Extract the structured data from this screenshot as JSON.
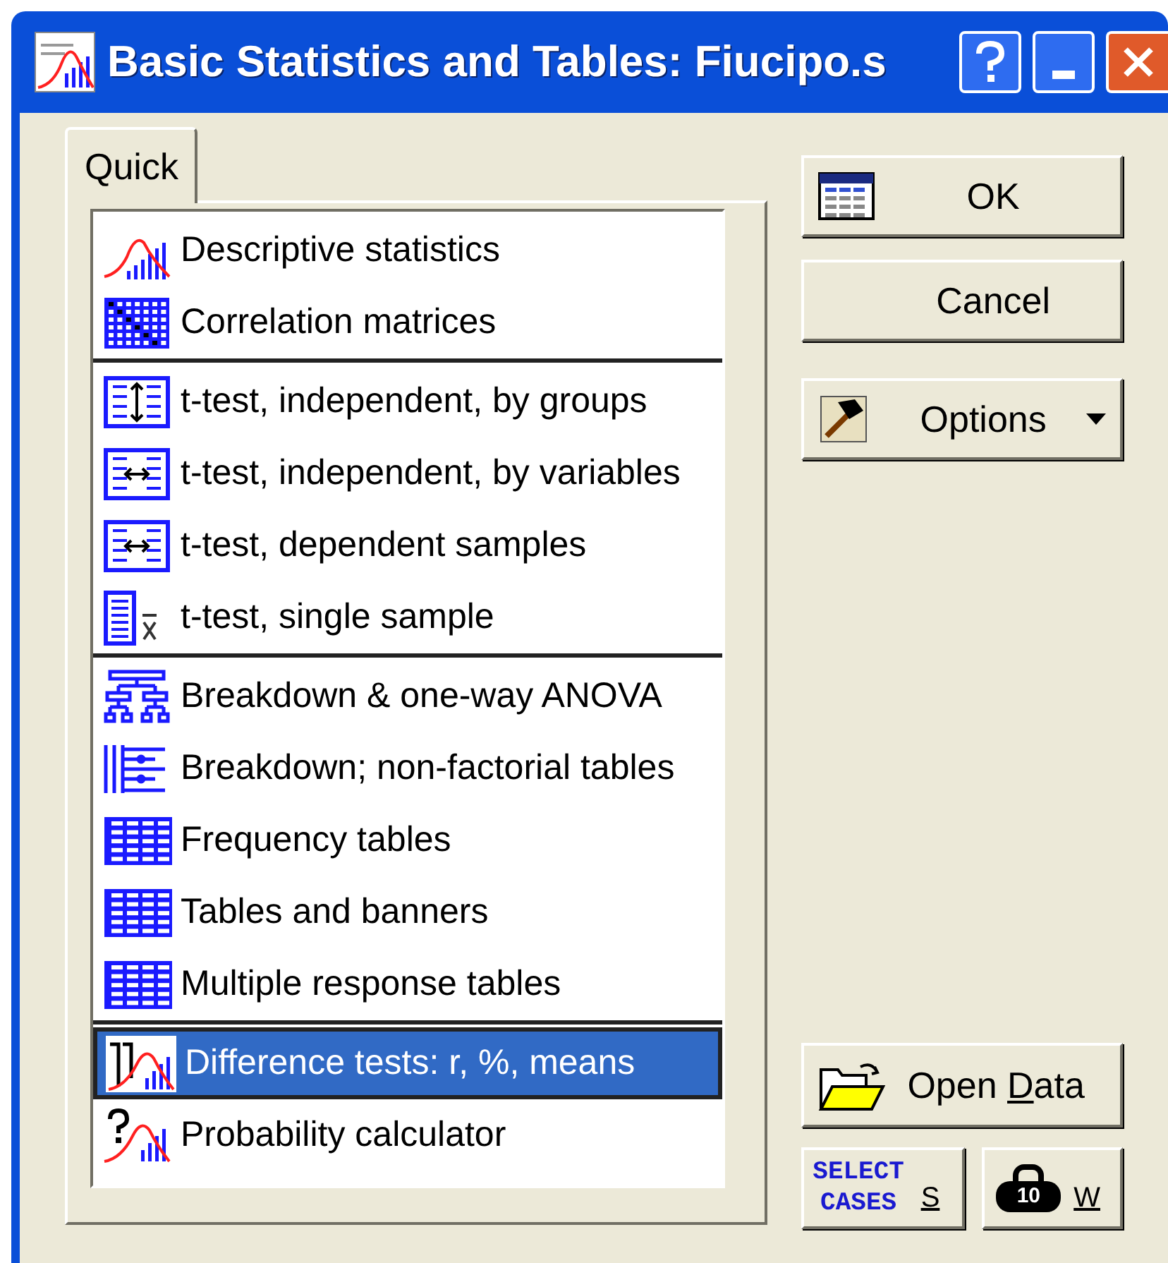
{
  "window": {
    "title": "Basic Statistics and Tables: Fiucipo.s"
  },
  "tabs": [
    {
      "label": "Quick",
      "selected": true
    }
  ],
  "groups": [
    {
      "items": [
        {
          "label": "Descriptive statistics",
          "kind": "distribution",
          "selected": false
        },
        {
          "label": "Correlation matrices",
          "kind": "matrix",
          "selected": false
        }
      ]
    },
    {
      "items": [
        {
          "label": "t-test, independent, by groups",
          "kind": "groups",
          "selected": false
        },
        {
          "label": "t-test, independent, by variables",
          "kind": "variables",
          "selected": false
        },
        {
          "label": "t-test, dependent samples",
          "kind": "variables",
          "selected": false
        },
        {
          "label": "t-test, single sample",
          "kind": "single",
          "selected": false
        }
      ]
    },
    {
      "items": [
        {
          "label": "Breakdown & one-way ANOVA",
          "kind": "tree",
          "selected": false
        },
        {
          "label": "Breakdown; non-factorial tables",
          "kind": "breakdown",
          "selected": false
        },
        {
          "label": "Frequency tables",
          "kind": "table",
          "selected": false
        },
        {
          "label": "Tables and banners",
          "kind": "table",
          "selected": false
        },
        {
          "label": "Multiple response tables",
          "kind": "table",
          "selected": false
        }
      ]
    },
    {
      "items": [
        {
          "label": "Difference tests: r, %, means",
          "kind": "difference",
          "selected": true
        },
        {
          "label": "Probability calculator",
          "kind": "probability",
          "selected": false
        }
      ]
    }
  ],
  "buttons": [
    {
      "kind": "ok",
      "label": "OK"
    },
    {
      "kind": "cancel",
      "label": "Cancel"
    },
    {
      "kind": "options",
      "label": "Options"
    }
  ],
  "open_data": {
    "label_parts": [
      {
        "text": "Open ",
        "underlined": false
      },
      {
        "text": "D",
        "underlined": true
      },
      {
        "text": "ata",
        "underlined": false
      }
    ]
  },
  "select_cases": {
    "badge": [
      "SELECT",
      "CASES"
    ],
    "key": "S"
  },
  "weight": {
    "badge": "10",
    "key": "W"
  }
}
